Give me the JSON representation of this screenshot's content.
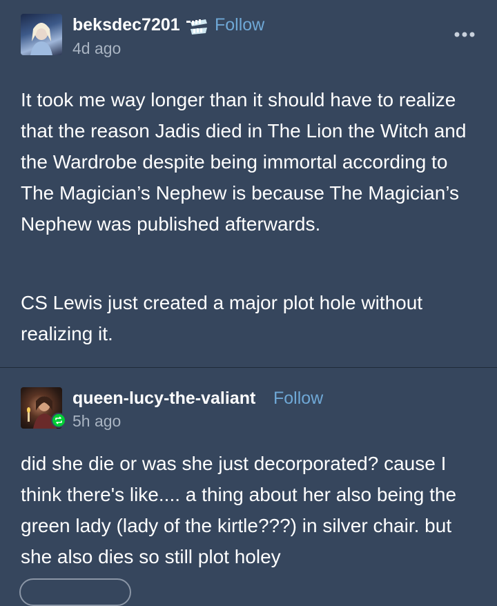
{
  "post1": {
    "username": "beksdec7201",
    "follow_label": "Follow",
    "time": "4d ago",
    "avatar_icon": "avatar-elsa-icon",
    "badge_icon": "badge-teeth-icon",
    "more_icon": "more-dots-icon",
    "paragraphs": [
      "It took me way longer than it should have to realize that the reason Jadis died in The Lion the Witch and the Wardrobe despite being immortal according to The Magician’s Nephew is because The Magician’s Nephew was published afterwards.",
      "CS Lewis just created a major plot hole without realizing it."
    ]
  },
  "post2": {
    "username": "queen-lucy-the-valiant",
    "follow_label": "Follow",
    "time": "5h ago",
    "avatar_icon": "avatar-candle-icon",
    "reblog_icon": "reblog-icon",
    "text": "did she die or was she just decorporated? cause I think there's like.... a thing about her also being the green lady (lady of the kirtle???) in silver chair. but she also dies so still plot holey"
  },
  "colors": {
    "background": "#36465d",
    "follow": "#6fa8d6",
    "timestamp": "#a9b4c2",
    "reblog_badge": "#00cf35"
  }
}
